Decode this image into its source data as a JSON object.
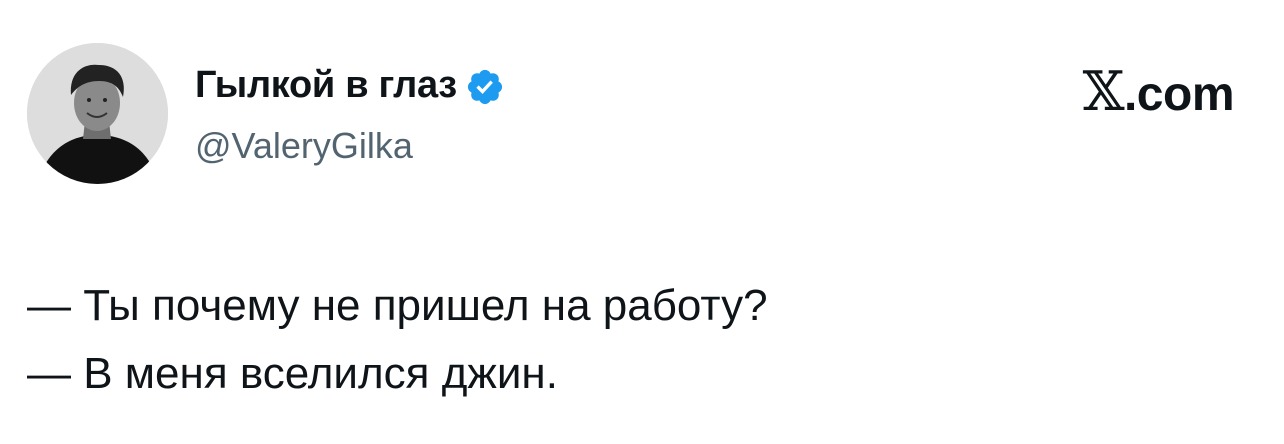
{
  "author": {
    "display_name": "Гылкой в глаз",
    "handle": "@ValeryGilka",
    "verified": true,
    "verified_color": "#1d9bf0",
    "avatar_icon": "avatar-photo"
  },
  "brand": {
    "label": "X.com",
    "x_glyph": "𝕏",
    "suffix": ".com"
  },
  "tweet": {
    "lines": [
      "— Ты почему не пришел на работу?",
      "— В меня вселился джин."
    ]
  },
  "colors": {
    "text": "#0f1419",
    "secondary": "#536471",
    "background": "#ffffff"
  }
}
